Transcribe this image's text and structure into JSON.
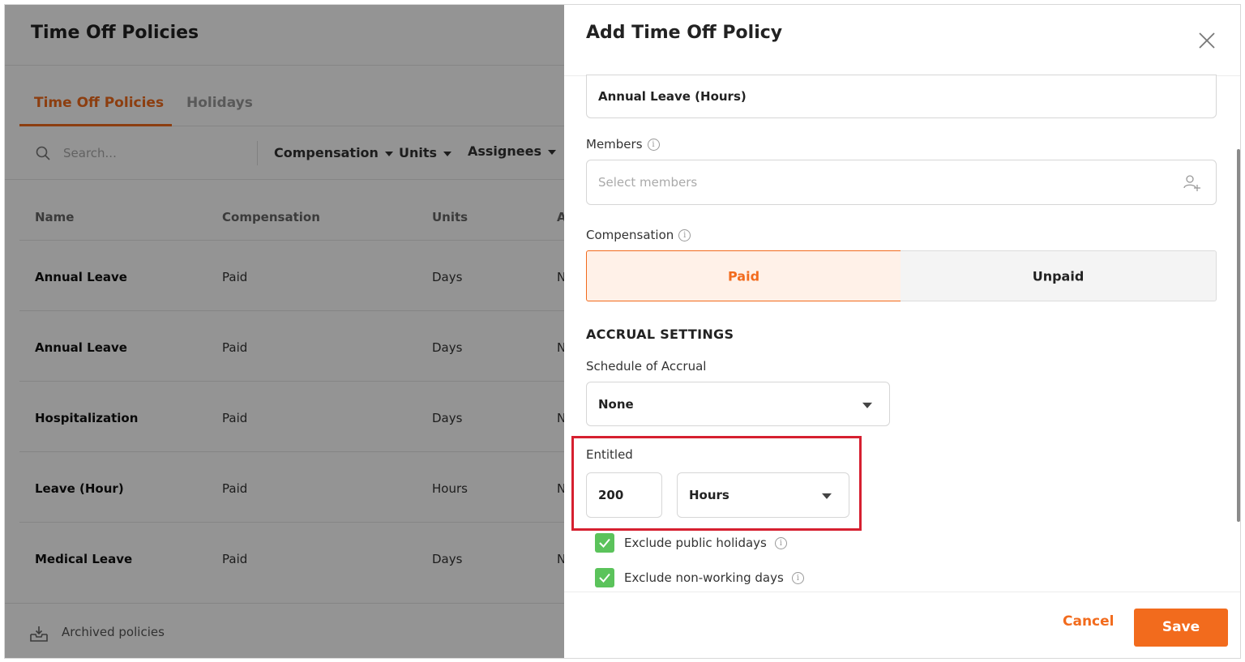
{
  "background_page": {
    "title": "Time Off Policies",
    "tabs": [
      {
        "label": "Time Off Policies",
        "active": true
      },
      {
        "label": "Holidays",
        "active": false
      }
    ],
    "search_placeholder": "Search...",
    "filters": [
      "Compensation",
      "Units",
      "Assignees"
    ],
    "table": {
      "headers": [
        "Name",
        "Compensation",
        "Units",
        "A"
      ],
      "rows": [
        {
          "name": "Annual Leave",
          "compensation": "Paid",
          "units": "Days",
          "extra": "N"
        },
        {
          "name": "Annual Leave",
          "compensation": "Paid",
          "units": "Days",
          "extra": "N"
        },
        {
          "name": "Hospitalization",
          "compensation": "Paid",
          "units": "Days",
          "extra": "N"
        },
        {
          "name": "Leave (Hour)",
          "compensation": "Paid",
          "units": "Hours",
          "extra": "N"
        },
        {
          "name": "Medical Leave",
          "compensation": "Paid",
          "units": "Days",
          "extra": "N"
        }
      ]
    },
    "footer_link": "Archived policies"
  },
  "modal": {
    "title": "Add Time Off Policy",
    "policy_name_value": "Annual Leave (Hours)",
    "members_label": "Members",
    "members_placeholder": "Select members",
    "compensation_label": "Compensation",
    "compensation_options": [
      "Paid",
      "Unpaid"
    ],
    "compensation_selected": "Paid",
    "accrual_section_title": "ACCRUAL SETTINGS",
    "schedule_label": "Schedule of Accrual",
    "schedule_value": "None",
    "entitled_label": "Entitled",
    "entitled_value": "200",
    "entitled_unit": "Hours",
    "checkboxes": [
      {
        "label": "Exclude public holidays",
        "checked": true
      },
      {
        "label": "Exclude non-working days",
        "checked": true
      }
    ],
    "cancel_label": "Cancel",
    "save_label": "Save"
  },
  "colors": {
    "accent": "#f26b1d",
    "highlight_border": "#d62030",
    "checkbox_green": "#5bc35b"
  }
}
